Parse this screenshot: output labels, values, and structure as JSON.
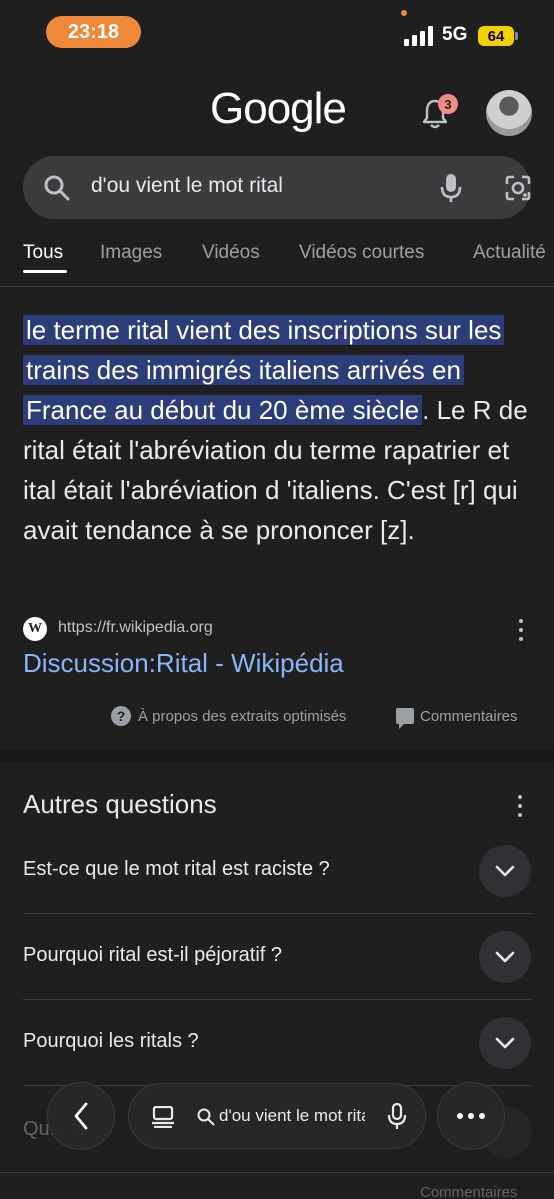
{
  "status_bar": {
    "time": "23:18",
    "network": "5G",
    "battery": "64"
  },
  "header": {
    "logo": "Google",
    "notification_count": "3"
  },
  "search": {
    "query": "d'ou vient le mot rital"
  },
  "tabs": [
    "Tous",
    "Images",
    "Vidéos",
    "Vidéos courtes",
    "Actualité"
  ],
  "snippet": {
    "highlighted": "le terme rital vient des inscriptions sur les trains des immigrés italiens arrivés en France au début du 20 ème siècle",
    "rest": ". Le R de rital était l'abréviation du terme rapatrier et ital était l'abréviation d 'italiens. C'est [r] qui avait tendance à se prononcer [z].",
    "source_icon": "W",
    "source_url": "https://fr.wikipedia.org",
    "link_title": "Discussion:Rital - Wikipédia",
    "about": "À propos des extraits optimisés",
    "feedback": "Commentaires"
  },
  "paa": {
    "title": "Autres questions",
    "questions": [
      "Est-ce que le mot rital est raciste ?",
      "Pourquoi rital est-il péjoratif ?",
      "Pourquoi les ritals ?"
    ],
    "faded_question": "Qu... le",
    "feedback": "Commentaires"
  },
  "bottom_nav": {
    "search_text": "d'ou vient le mot rital"
  },
  "colors": {
    "accent_orange": "#f0883a",
    "link_blue": "#8ab4f8",
    "highlight": "#2c3d7a",
    "battery": "#f5d000"
  }
}
